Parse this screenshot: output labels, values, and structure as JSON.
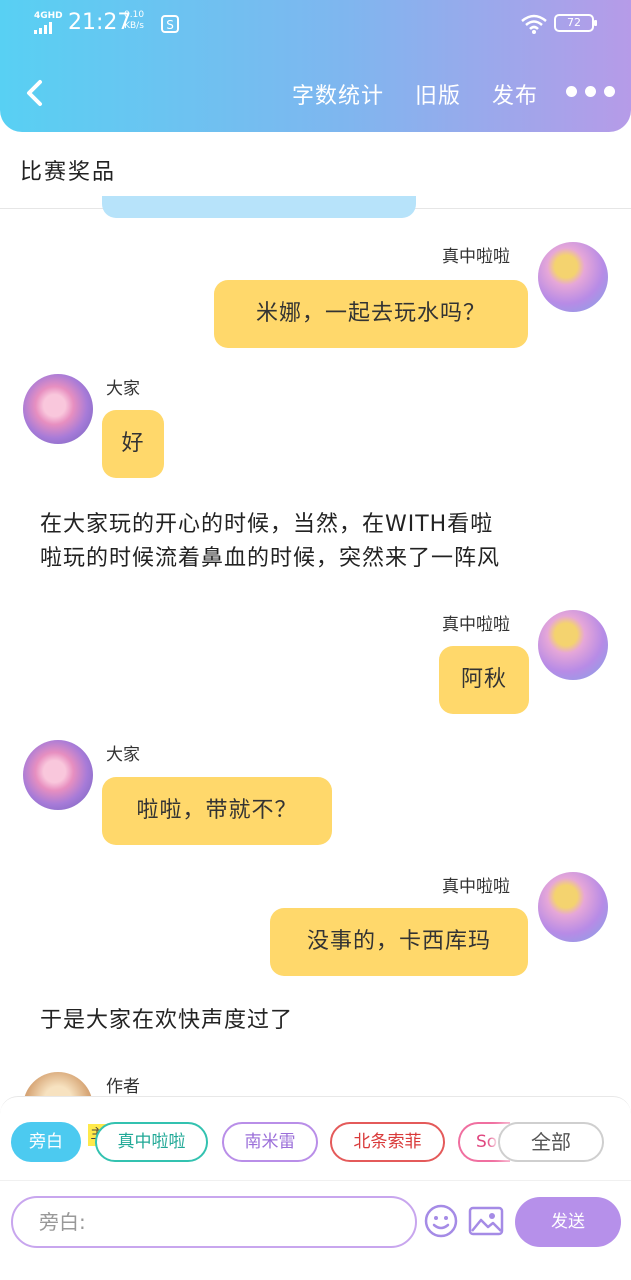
{
  "status_bar": {
    "network": "4GHD",
    "time": "21:27",
    "speed_value": "0.10",
    "speed_unit": "KB/s",
    "battery": "72"
  },
  "header": {
    "word_count_label": "字数统计",
    "old_version_label": "旧版",
    "publish_label": "发布",
    "subtitle": "比赛奖品"
  },
  "messages": [
    {
      "type": "right",
      "name": "真中啦啦",
      "text": "米娜，一起去玩水吗？"
    },
    {
      "type": "left",
      "name": "大家",
      "text": "好"
    },
    {
      "type": "narration",
      "lines": [
        "在大家玩的开心的时候，当然，在WITH看啦",
        "啦玩的时候流着鼻血的时候，突然来了一阵风"
      ]
    },
    {
      "type": "right",
      "name": "真中啦啦",
      "text": "阿秋"
    },
    {
      "type": "left",
      "name": "大家",
      "text": "啦啦，带就不？"
    },
    {
      "type": "right",
      "name": "真中啦啦",
      "text": "没事的，卡西库玛"
    },
    {
      "type": "narration",
      "lines": [
        "于是大家在欢快声度过了"
      ]
    },
    {
      "type": "left",
      "name": "作者"
    }
  ],
  "composer": {
    "role_chips": [
      "旁白",
      "真中啦啦",
      "南米雷",
      "北条索菲",
      "Sol"
    ],
    "host_badge": "主",
    "all_label": "全部",
    "input_placeholder": "旁白:",
    "send_label": "发送"
  },
  "colors": {
    "header_gradient_start": "#58d0f3",
    "header_gradient_end": "#b69be8",
    "bubble": "#ffd86b",
    "send_button": "#b690ea"
  }
}
